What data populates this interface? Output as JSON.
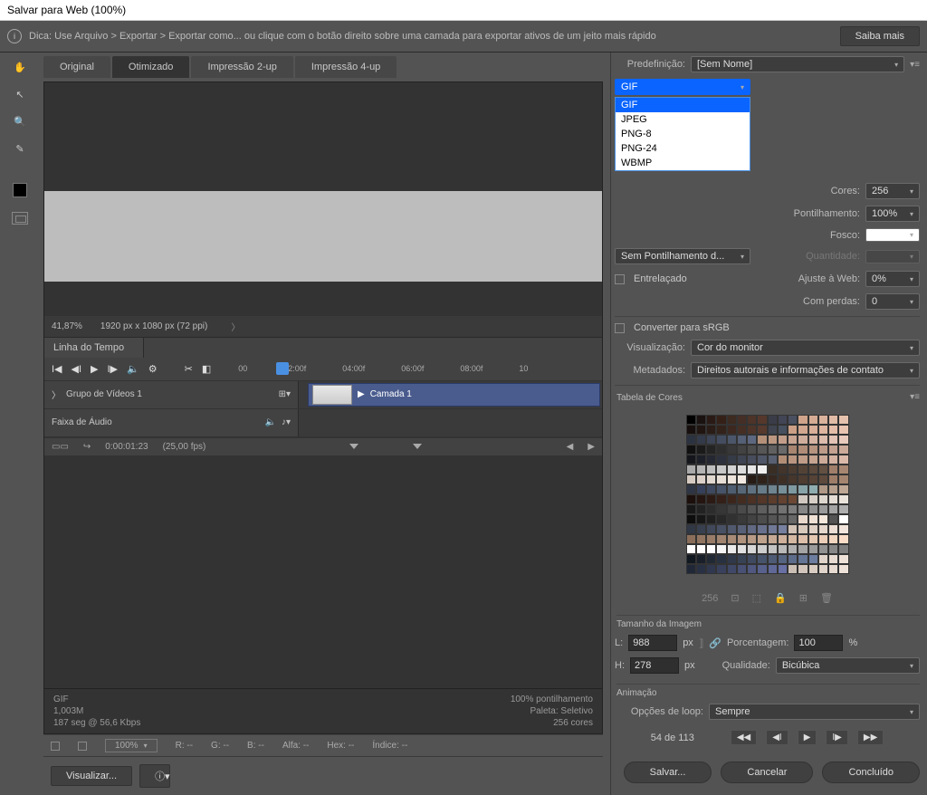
{
  "title": "Salvar para Web (100%)",
  "hint": "Dica: Use Arquivo > Exportar > Exportar como... ou clique com o botão direito sobre uma camada para exportar ativos de um jeito mais rápido",
  "learn_more": "Saiba mais",
  "tabs": {
    "original": "Original",
    "optimized": "Otimizado",
    "two_up": "Impressão 2-up",
    "four_up": "Impressão 4-up"
  },
  "zoom": {
    "percent": "41,87%",
    "dims": "1920 px x 1080 px (72 ppi)"
  },
  "timeline": {
    "tab": "Linha do Tempo",
    "marks": [
      "00",
      "02:00f",
      "04:00f",
      "06:00f",
      "08:00f",
      "10"
    ],
    "group": "Grupo de Vídeos 1",
    "layer": "Camada 1",
    "audio": "Faixa de Áudio",
    "time": "0:00:01:23",
    "fps": "(25,00 fps)"
  },
  "meta": {
    "format": "GIF",
    "size": "1,003M",
    "rate": "187 seg @ 56,6 Kbps",
    "dither": "100% pontilhamento",
    "palette": "Paleta: Seletivo",
    "colors": "256 cores"
  },
  "status": {
    "zoom": "100%",
    "r": "R: --",
    "g": "G: --",
    "b": "B: --",
    "alpha": "Alfa: --",
    "hex": "Hex: --",
    "index": "Índice: --"
  },
  "footer": {
    "preview": "Visualizar...",
    "save": "Salvar...",
    "cancel": "Cancelar",
    "done": "Concluído"
  },
  "right": {
    "preset_lbl": "Predefinição:",
    "preset_val": "[Sem Nome]",
    "format_sel": "GIF",
    "format_opts": [
      "GIF",
      "JPEG",
      "PNG-8",
      "PNG-24",
      "WBMP"
    ],
    "colors_lbl": "Cores:",
    "colors_val": "256",
    "dither_lbl": "Pontilhamento:",
    "dither_val": "100%",
    "matte_lbl": "Fosco:",
    "nodither": "Sem Pontilhamento d...",
    "amount_lbl": "Quantidade:",
    "interlaced": "Entrelaçado",
    "websnap_lbl": "Ajuste à Web:",
    "websnap_val": "0%",
    "lossy_lbl": "Com perdas:",
    "lossy_val": "0",
    "srgb": "Converter para sRGB",
    "view_lbl": "Visualização:",
    "view_val": "Cor do monitor",
    "meta_lbl": "Metadados:",
    "meta_val": "Direitos autorais e informações de contato",
    "ct_title": "Tabela de Cores",
    "ct_count": "256",
    "size_title": "Tamanho da Imagem",
    "w_lbl": "L:",
    "w_val": "988",
    "px": "px",
    "h_lbl": "H:",
    "h_val": "278",
    "pct_lbl": "Porcentagem:",
    "pct_val": "100",
    "pct_unit": "%",
    "qual_lbl": "Qualidade:",
    "qual_val": "Bicúbica",
    "anim_title": "Animação",
    "loop_lbl": "Opções de loop:",
    "loop_val": "Sempre",
    "frame": "54 de 113"
  },
  "ct_colors": [
    "#000",
    "#1a1210",
    "#2a1a15",
    "#352018",
    "#3d2a20",
    "#452e25",
    "#4d3328",
    "#55382b",
    "#3a3d48",
    "#414555",
    "#4a5060",
    "#cfa48a",
    "#d5ac93",
    "#dab39c",
    "#e0bba5",
    "#e5c2ad",
    "#170f0d",
    "#201511",
    "#2a1c16",
    "#33221a",
    "#3c281f",
    "#452e24",
    "#4e3428",
    "#573a2d",
    "#3f4450",
    "#47505f",
    "#cba086",
    "#d1a78f",
    "#d8af98",
    "#deb6a0",
    "#e4bda8",
    "#e9c4b1",
    "#2b3240",
    "#333a4a",
    "#3c4455",
    "#444d60",
    "#4c566a",
    "#555f75",
    "#5d6880",
    "#b49079",
    "#bb9781",
    "#c29e8a",
    "#c8a593",
    "#cfad9c",
    "#d6b4a4",
    "#dcbcad",
    "#e3c3b5",
    "#e9cabc",
    "#101010",
    "#1a1a1a",
    "#242424",
    "#2e2e2e",
    "#383838",
    "#424242",
    "#4c4c4c",
    "#565656",
    "#606060",
    "#6a6a6a",
    "#a88570",
    "#af8c78",
    "#b69480",
    "#bd9b89",
    "#c4a291",
    "#cbaa9a",
    "#14161c",
    "#1c1f27",
    "#252832",
    "#2d313d",
    "#363b48",
    "#3e4452",
    "#474d5d",
    "#4f5668",
    "#586072",
    "#b28d76",
    "#b9957f",
    "#bf9c87",
    "#c6a490",
    "#cdab98",
    "#d4b2a1",
    "#dab9a9",
    "#aaa",
    "#b4b4b4",
    "#bebebe",
    "#c8c8c8",
    "#d2d2d2",
    "#dcdcdc",
    "#e6e6e6",
    "#f0f0f0",
    "#3a2d24",
    "#42342a",
    "#4a3b30",
    "#524236",
    "#5a493c",
    "#625042",
    "#a07f6a",
    "#a78771",
    "#d6cbc2",
    "#dcd1c9",
    "#e1d8d0",
    "#e7ded6",
    "#ede4dc",
    "#f2eae2",
    "#261b15",
    "#2e221a",
    "#362820",
    "#3e2f25",
    "#46362b",
    "#4e3c31",
    "#564337",
    "#5e4a3c",
    "#9e7d68",
    "#a5856f",
    "#2e3645",
    "#36405a",
    "#3e4960",
    "#475368",
    "#4f5d70",
    "#576778",
    "#5f7180",
    "#677b88",
    "#6f8590",
    "#778f98",
    "#7f99a0",
    "#87a3a8",
    "#8fadb0",
    "#af9885",
    "#b6a08d",
    "#bea794",
    "#1c0f0c",
    "#241510",
    "#2c1a14",
    "#342018",
    "#3c261c",
    "#442c20",
    "#4c3124",
    "#543728",
    "#5c3d2c",
    "#644230",
    "#6c4834",
    "#d0c8c0",
    "#d7cfc7",
    "#ddd6ce",
    "#e4ddd5",
    "#eae3db",
    "#181818",
    "#222",
    "#2c2c2c",
    "#363636",
    "#404040",
    "#4a4a4a",
    "#545454",
    "#5e5e5e",
    "#686868",
    "#727272",
    "#7c7c7c",
    "#868686",
    "#909090",
    "#9a9a9a",
    "#a4a4a4",
    "#aeaeae",
    "#0d0d0d",
    "#161616",
    "#1f1f1f",
    "#282828",
    "#313131",
    "#3a3a3a",
    "#434343",
    "#4c4c4c",
    "#555",
    "#5e5e5e",
    "#676767",
    "#e8d8cc",
    "#eee0d4",
    "#f4e7db",
    "#fae eee3",
    "#fff",
    "#303846",
    "#384050",
    "#40485a",
    "#485064",
    "#50586e",
    "#586078",
    "#606882",
    "#68708c",
    "#707896",
    "#7880a0",
    "#d2c2b6",
    "#d8c9bd",
    "#dfd0c5",
    "#e5d7cc",
    "#ecded4",
    "#f2e5db",
    "#8a6e5a",
    "#927561",
    "#997c68",
    "#a1846f",
    "#a88b76",
    "#b0937e",
    "#b79a85",
    "#bfa28c",
    "#c6a994",
    "#ceb09b",
    "#d5b8a2",
    "#ddbfaa",
    "#e4c7b1",
    "#ecceb8",
    "#f3d6c0",
    "#fbddc7",
    "#fff",
    "#fff",
    "#fff",
    "#f5f5f5",
    "#ebebeb",
    "#e1e1e1",
    "#d7d7d7",
    "#cdcdcd",
    "#c3c3c3",
    "#b9b9b9",
    "#afafaf",
    "#a5a5a5",
    "#9b9b9b",
    "#919191",
    "#878787",
    "#7d7d7d",
    "#121820",
    "#19202a",
    "#212935",
    "#283140",
    "#30394a",
    "#374255",
    "#3f4a60",
    "#46536a",
    "#4e5b75",
    "#556480",
    "#5d6c8a",
    "#647595",
    "#6c7da0",
    "#e0d4ca",
    "#e7dbd1",
    "#eee2d8",
    "#202838",
    "#283044",
    "#303850",
    "#38405c",
    "#404868",
    "#485074",
    "#505880",
    "#58608c",
    "#606898",
    "#6870a4",
    "#cbbfb5",
    "#d2c6bc",
    "#d9cdc3",
    "#e0d4cb",
    "#e7dbd2",
    "#eee2d9"
  ]
}
